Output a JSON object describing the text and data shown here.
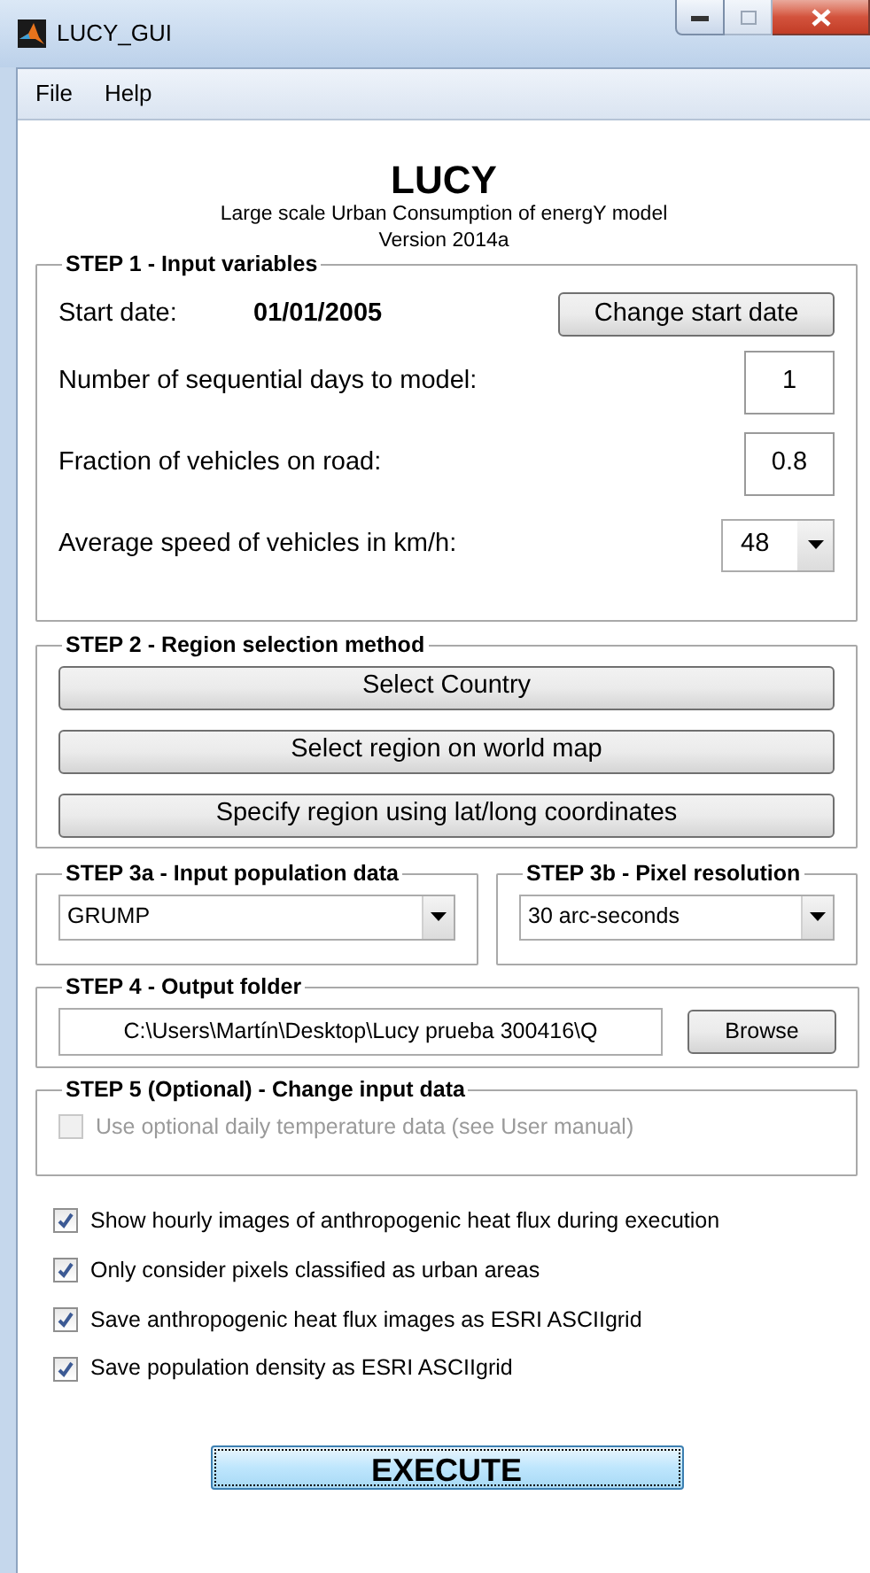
{
  "window": {
    "title": "LUCY_GUI"
  },
  "menu": [
    "File",
    "Help"
  ],
  "header": {
    "title": "LUCY",
    "subtitle": "Large scale Urban Consumption of energY model",
    "version": "Version 2014a"
  },
  "step1": {
    "title": "STEP 1 - Input variables",
    "start_date_label": "Start date:",
    "start_date": "01/01/2005",
    "change_button": "Change start date",
    "fields": [
      {
        "kind": "text",
        "label": "Number of sequential days to model:",
        "value": "1"
      },
      {
        "kind": "text",
        "label": "Fraction of vehicles on road:",
        "value": "0.8"
      },
      {
        "kind": "dropdown",
        "label": "Average speed of vehicles in km/h:",
        "value": "48"
      }
    ]
  },
  "step2": {
    "title": "STEP 2 - Region selection method",
    "buttons": [
      "Select Country",
      "Select region on world map",
      "Specify region using lat/long coordinates"
    ]
  },
  "step3a": {
    "title": "STEP 3a - Input population data",
    "value": "GRUMP"
  },
  "step3b": {
    "title": "STEP 3b - Pixel resolution",
    "value": "30 arc-seconds"
  },
  "step4": {
    "title": "STEP 4 - Output folder",
    "path": "C:\\Users\\Martín\\Desktop\\Lucy prueba 300416\\Q",
    "browse_button": "Browse"
  },
  "step5": {
    "title": "STEP 5 (Optional) - Change input data",
    "option": {
      "label": "Use optional daily temperature data (see User manual)",
      "checked": false,
      "disabled": true
    }
  },
  "options": [
    {
      "label": "Show hourly images of anthropogenic heat flux during execution",
      "checked": true
    },
    {
      "label": "Only consider pixels classified as urban areas",
      "checked": true
    },
    {
      "label": "Save anthropogenic heat flux images as ESRI ASCIIgrid",
      "checked": true
    },
    {
      "label": "Save population density as ESRI ASCIIgrid",
      "checked": true
    }
  ],
  "execute_button": {
    "label": "EXECUTE",
    "focused": true
  }
}
